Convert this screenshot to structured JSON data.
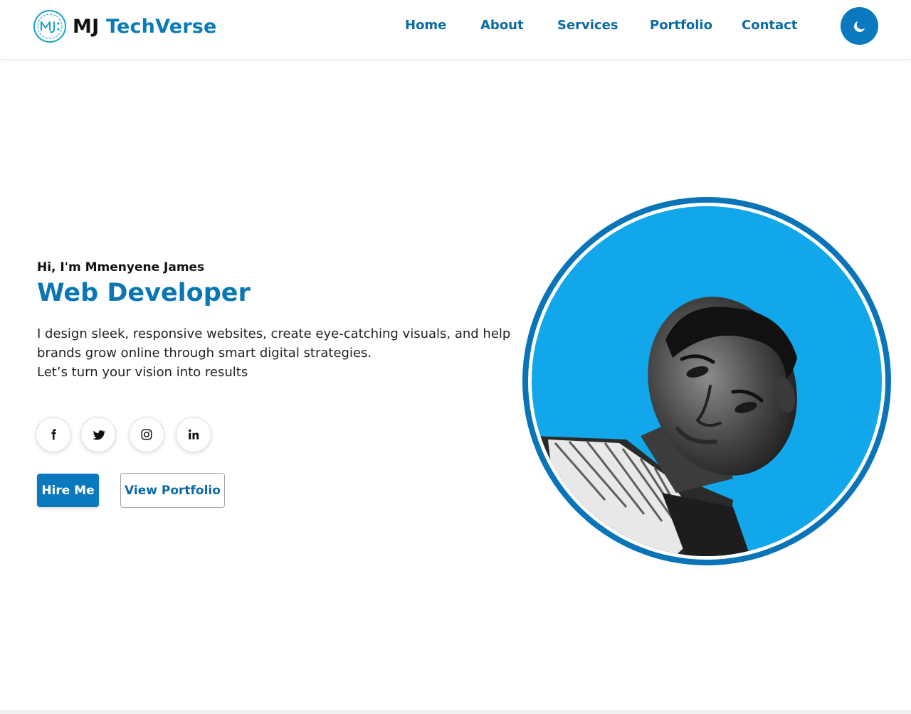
{
  "brand": {
    "mark_letters": "MJ",
    "name_part1": "MJ",
    "name_part2": "TechVerse"
  },
  "nav": {
    "items": [
      {
        "label": "Home"
      },
      {
        "label": "About"
      },
      {
        "label": "Services"
      },
      {
        "label": "Portfolio"
      },
      {
        "label": "Contact"
      }
    ],
    "theme_toggle_icon": "moon-icon"
  },
  "hero": {
    "greeting": "Hi, I'm Mmenyene James",
    "role": "Web Developer",
    "intro_line1": "I design sleek, responsive websites, create eye-catching visuals, and help brands grow online through smart digital strategies.",
    "intro_line2": "Let’s turn your vision into results",
    "socials": [
      {
        "icon": "facebook-icon"
      },
      {
        "icon": "twitter-icon"
      },
      {
        "icon": "instagram-icon"
      },
      {
        "icon": "linkedin-icon"
      }
    ],
    "primary_button": "Hire Me",
    "secondary_button": "View Portfolio"
  },
  "colors": {
    "accent": "#0a79bd",
    "accent_text": "#0a6aa3",
    "portrait_background": "#0ea5e9"
  }
}
